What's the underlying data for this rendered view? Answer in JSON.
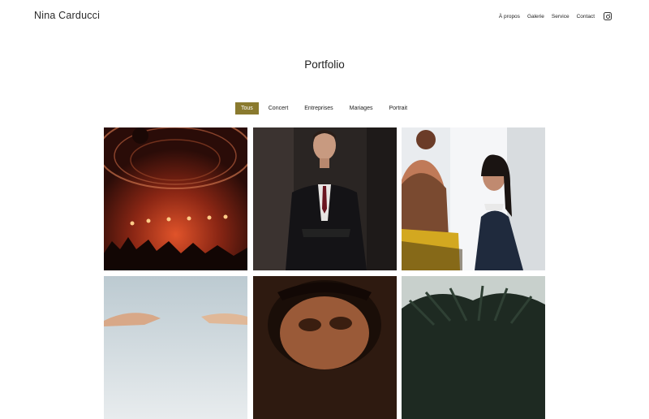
{
  "site": {
    "brand": "Nina Carducci"
  },
  "nav": {
    "items": [
      "À propos",
      "Galerie",
      "Service",
      "Contact"
    ],
    "social_icon": "instagram-icon"
  },
  "page": {
    "title": "Portfolio"
  },
  "filters": {
    "items": [
      "Tous",
      "Concert",
      "Entreprises",
      "Mariages",
      "Portrait"
    ],
    "active": "Tous"
  },
  "gallery": {
    "photos": [
      {
        "subject": "concert-crowd-stage"
      },
      {
        "subject": "businessman-suit"
      },
      {
        "subject": "businesswoman-meeting"
      },
      {
        "subject": "hands-sky"
      },
      {
        "subject": "portrait-man"
      },
      {
        "subject": "palm-leaves"
      }
    ]
  },
  "colors": {
    "accent": "#8a7a2e",
    "background": "#ffffff",
    "text": "#222222"
  }
}
